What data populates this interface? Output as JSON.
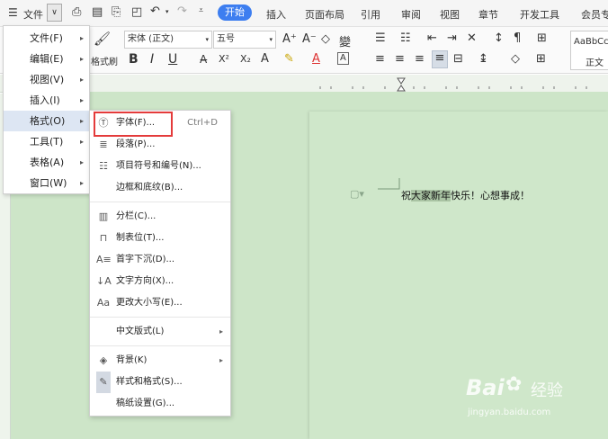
{
  "menubar": {
    "menu_icon": "hamburger-icon",
    "file_label": "文件",
    "tabs": [
      "插入",
      "页面布局",
      "引用",
      "审阅",
      "视图",
      "章节",
      "开发工具",
      "会员专"
    ],
    "active_tab": "开始"
  },
  "ribbon": {
    "format_painter": "格式刷",
    "font_name": "宋体 (正文)",
    "font_size": "五号",
    "bold": "B",
    "italic": "I",
    "underline": "U",
    "superscript": "X²",
    "subscript": "X₂",
    "style_preview": "AaBbCc",
    "style_name": "正文"
  },
  "document": {
    "text_plain1": "祝",
    "text_hl": "大家新年",
    "text_plain2": "快乐！心想事成！"
  },
  "file_menu": {
    "items": [
      {
        "label": "文件(F)"
      },
      {
        "label": "编辑(E)"
      },
      {
        "label": "视图(V)"
      },
      {
        "label": "插入(I)"
      },
      {
        "label": "格式(O)"
      },
      {
        "label": "工具(T)"
      },
      {
        "label": "表格(A)"
      },
      {
        "label": "窗口(W)"
      }
    ]
  },
  "format_menu": {
    "font": {
      "label": "字体(F)...",
      "shortcut": "Ctrl+D"
    },
    "paragraph": "段落(P)...",
    "bullets": "项目符号和编号(N)...",
    "borders": "边框和底纹(B)...",
    "columns": "分栏(C)...",
    "tabs": "制表位(T)...",
    "dropcap": "首字下沉(D)...",
    "direction": "文字方向(X)...",
    "case": "更改大小写(E)...",
    "chinese": "中文版式(L)",
    "background": "背景(K)",
    "styles": "样式和格式(S)...",
    "manuscript": "稿纸设置(G)..."
  },
  "watermark": {
    "brand": "Bai",
    "brand_cn": "经验",
    "url": "jingyan.baidu.com"
  }
}
